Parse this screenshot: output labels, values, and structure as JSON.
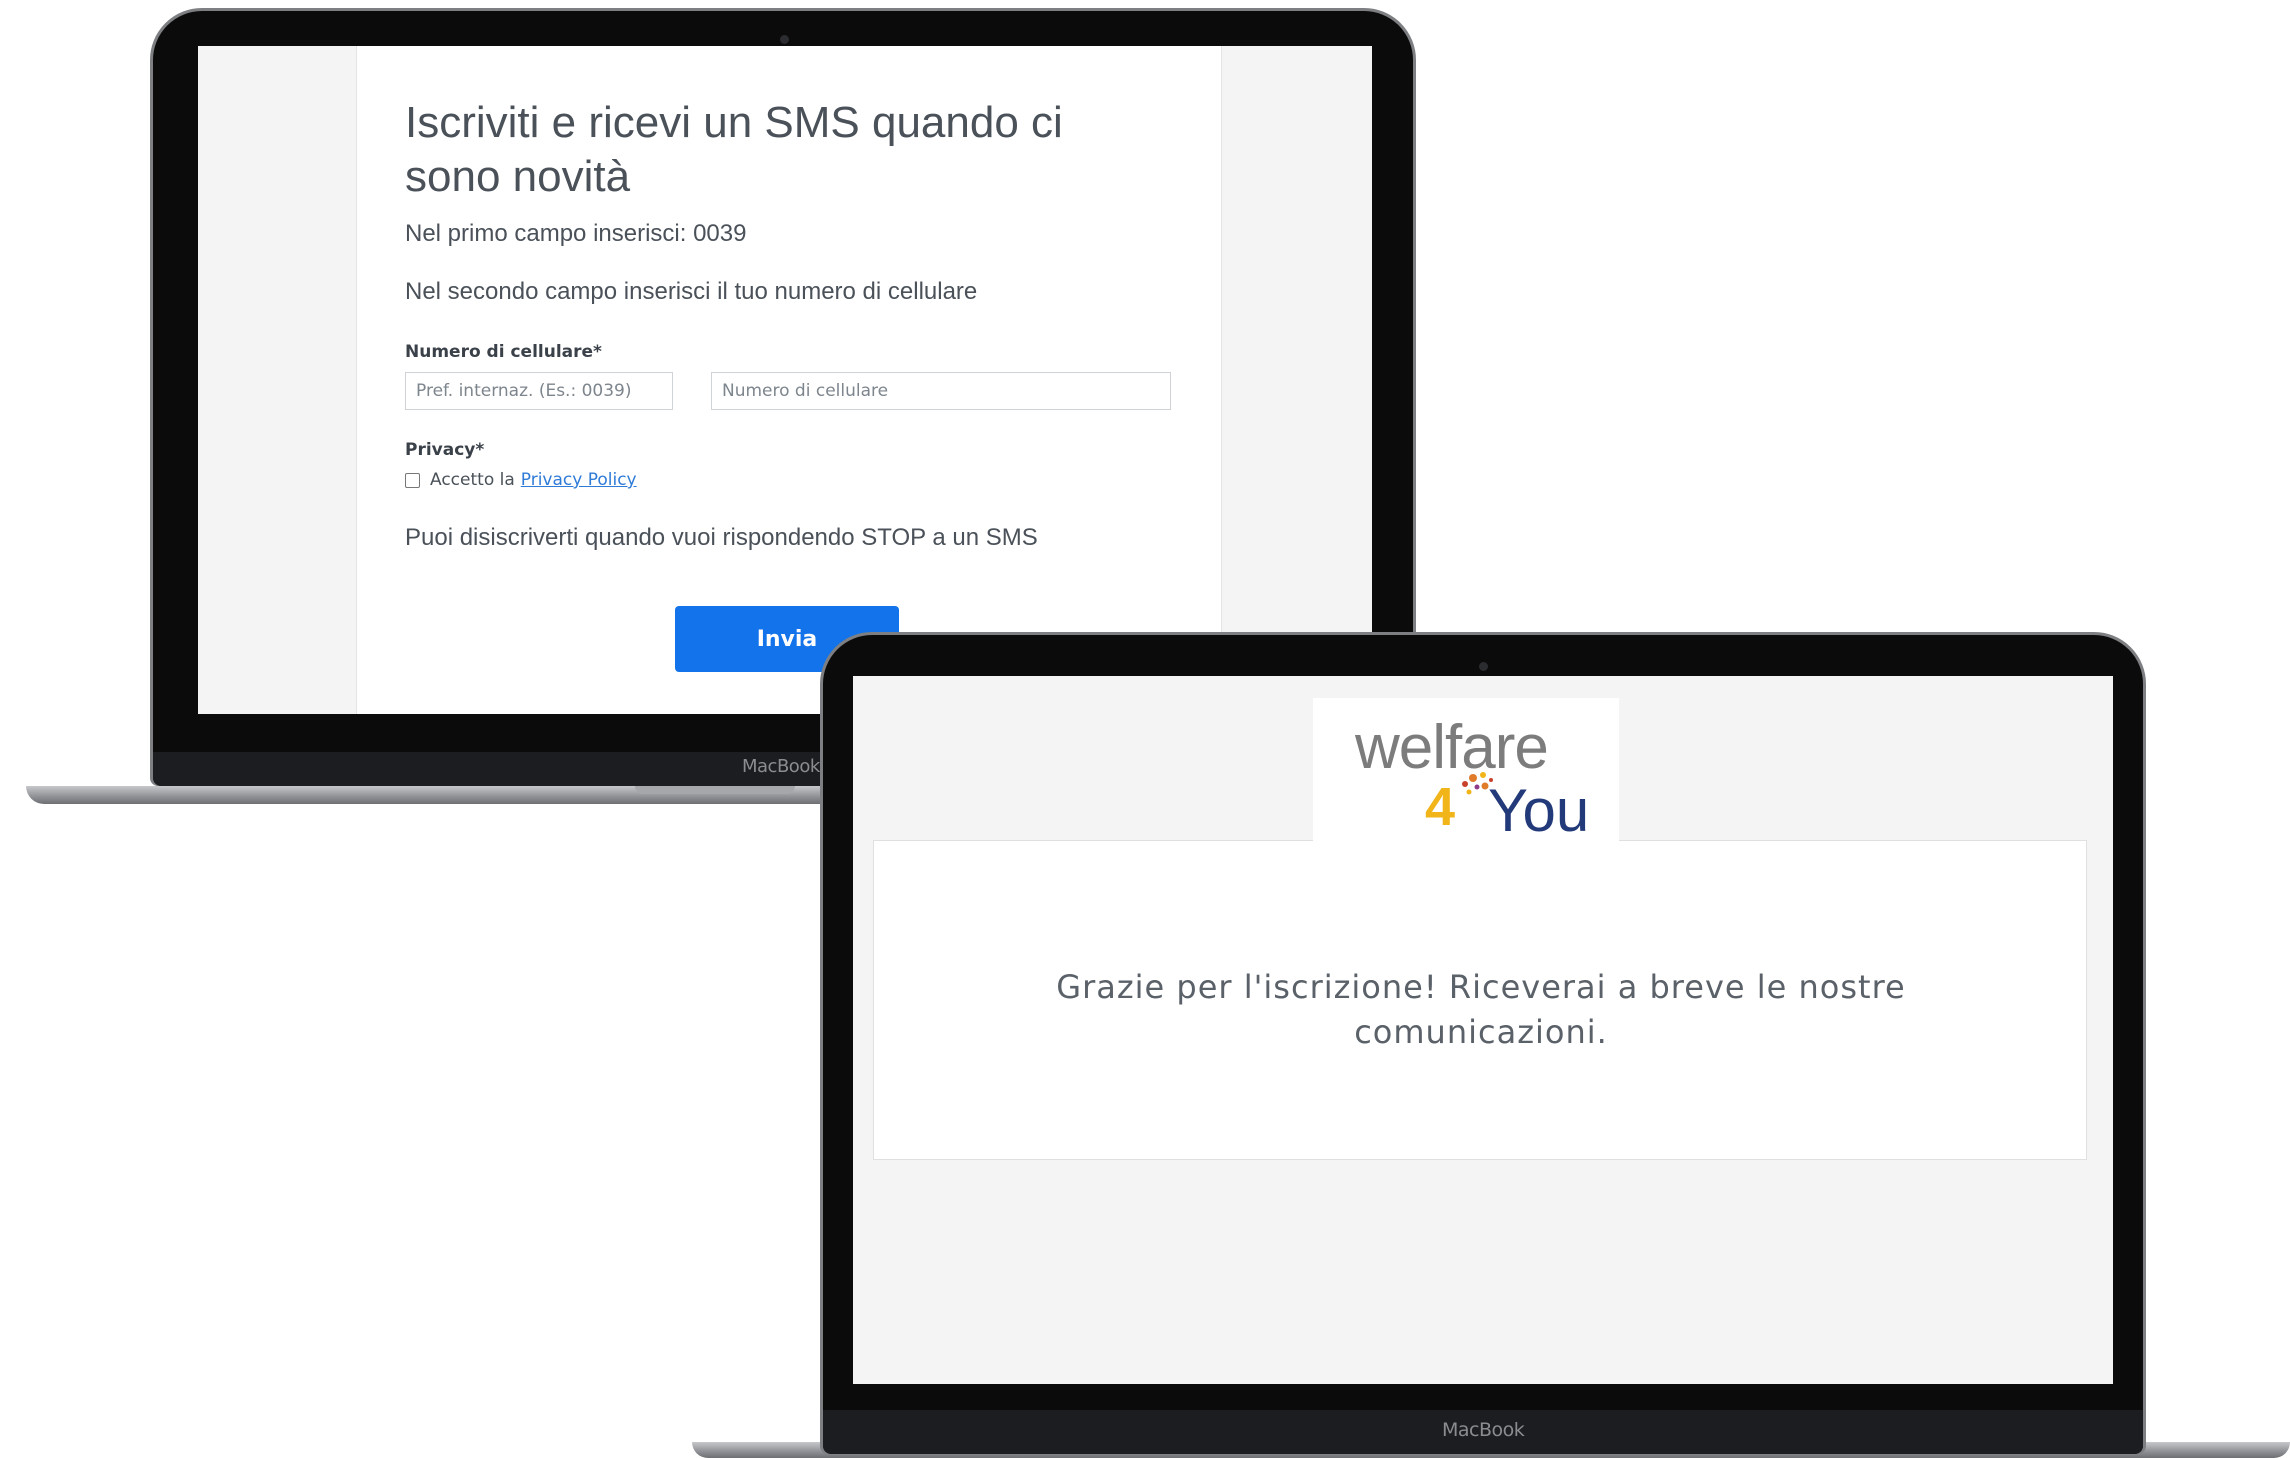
{
  "signup_screen": {
    "title": "Iscriviti e ricevi un SMS quando ci sono novità",
    "instruction_1": "Nel primo campo inserisci: 0039",
    "instruction_2": "Nel secondo campo inserisci il tuo numero di cellulare",
    "phone_label": "Numero di cellulare*",
    "prefix_placeholder": "Pref. internaz. (Es.: 0039)",
    "phone_placeholder": "Numero di cellulare",
    "privacy_label": "Privacy*",
    "privacy_checkbox_text": "Accetto la",
    "privacy_link_text": "Privacy Policy",
    "unsubscribe_note": "Puoi disiscriverti quando vuoi rispondendo STOP a un SMS",
    "submit_label": "Invia",
    "device_brand": "MacBook"
  },
  "thankyou_screen": {
    "logo": {
      "line1": "welfare",
      "digit": "4",
      "word": "You"
    },
    "message": "Grazie per l'iscrizione! Riceverai a breve le nostre comunicazioni.",
    "device_brand": "MacBook"
  },
  "colors": {
    "button_blue": "#1273eb",
    "link_blue": "#2f7bd8",
    "logo_gray": "#7c7c7c",
    "logo_yellow": "#f1b51a",
    "logo_navy": "#233a7a"
  }
}
